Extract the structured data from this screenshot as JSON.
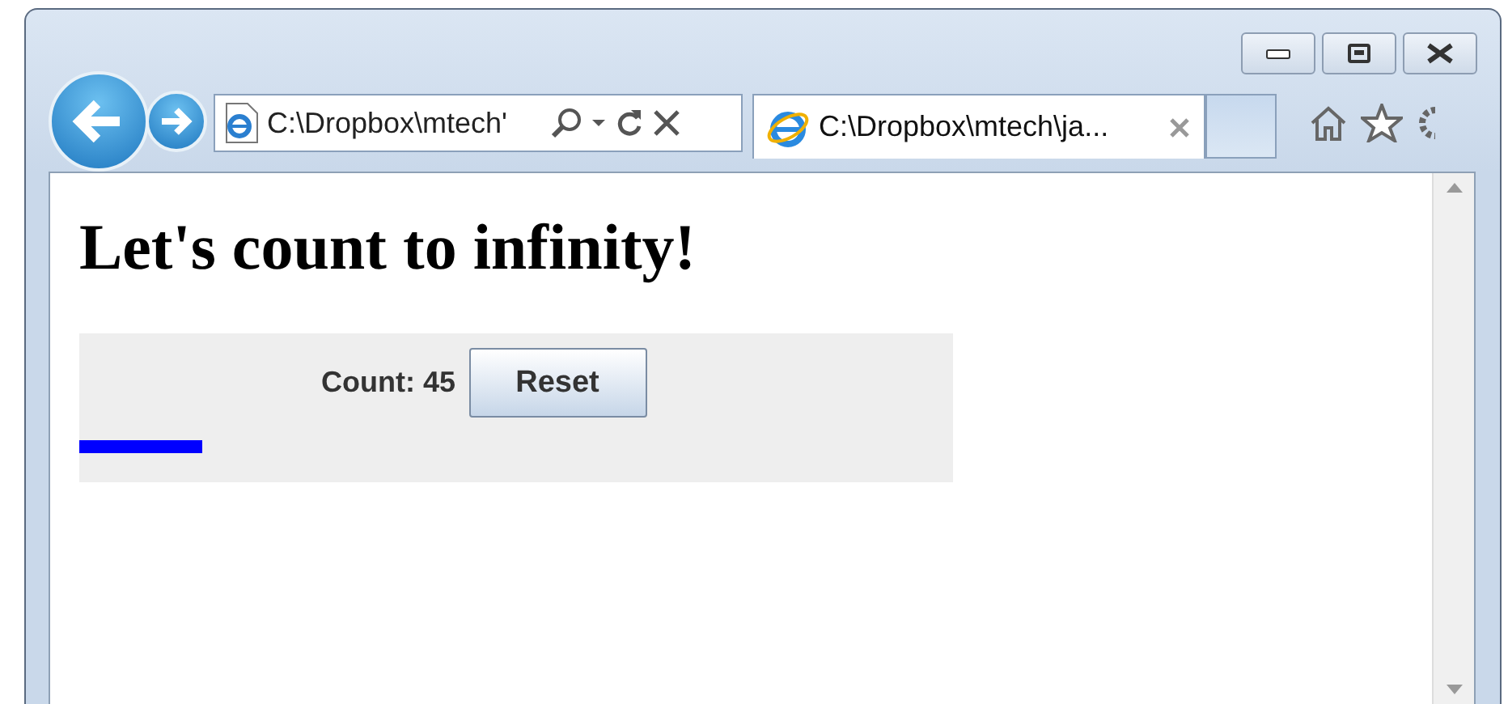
{
  "address_bar": {
    "url": "C:\\Dropbox\\mtech'"
  },
  "tabs": [
    {
      "title": "C:\\Dropbox\\mtech\\ja...",
      "selected": true
    }
  ],
  "page": {
    "heading": "Let's count to infinity!",
    "count_label": "Count: 45",
    "reset_button": "Reset",
    "progress": {
      "level": 0.14
    }
  }
}
